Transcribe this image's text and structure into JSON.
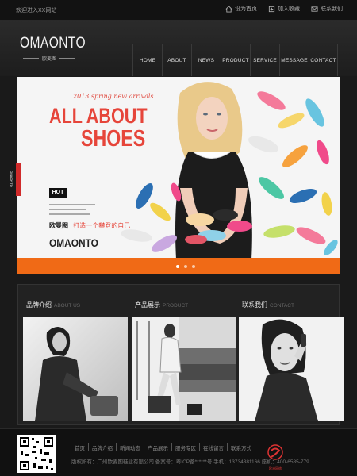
{
  "topbar": {
    "welcome": "欢迎进入XX网站",
    "links": [
      {
        "label": "设为首页",
        "icon": "home-icon"
      },
      {
        "label": "加入收藏",
        "icon": "bookmark-icon"
      },
      {
        "label": "联系我们",
        "icon": "contact-icon"
      }
    ]
  },
  "header": {
    "brand": "OMAONTO",
    "brand_sub": "欧麦图",
    "nav": [
      "HOME",
      "ABOUT",
      "NEWS",
      "PRODUCT",
      "SERVICE",
      "MESSAGE",
      "CONTACT"
    ]
  },
  "banner": {
    "script": "2013 spring new arrivals",
    "line1": "ALL ABOUT",
    "line2": "SHOES",
    "badge": "HOT",
    "cn_prefix": "欧曼图",
    "cn_slogan": "打造一个攀登的自己",
    "brand": "OMAONTO",
    "side_tag": "OMAONTO",
    "slides": 3,
    "active_slide": 1
  },
  "panels": [
    {
      "title": "品牌介绍",
      "subtitle": "ABOUT US"
    },
    {
      "title": "产品展示",
      "subtitle": "PRODUCT"
    },
    {
      "title": "联系我们",
      "subtitle": "CONTACT"
    }
  ],
  "footer": {
    "links": [
      "首页",
      "品牌介绍",
      "新闻动态",
      "产品展示",
      "服务专区",
      "在线留言",
      "联系方式"
    ],
    "info": "版权所有：广州欧麦图鞋业有限公司 备案号：粤ICP备******号 手机：13734381166 座机：400-6585-779",
    "logo_tag": "欧洲网络"
  },
  "colors": {
    "accent": "#f06a16",
    "red": "#e6453a",
    "bg": "#1a1a1a"
  }
}
